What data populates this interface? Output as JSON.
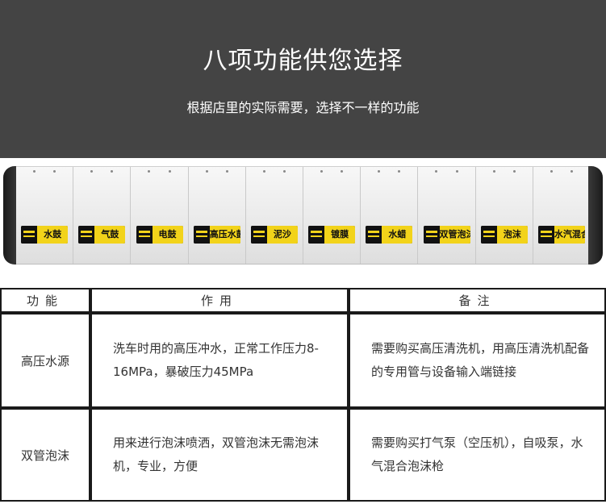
{
  "header": {
    "title": "八项功能供您选择",
    "subtitle": "根据店里的实际需要，选择不一样的功能"
  },
  "product": {
    "modules": [
      {
        "label": "水鼓"
      },
      {
        "label": "气鼓"
      },
      {
        "label": "电鼓"
      },
      {
        "label": "高压水鼓"
      },
      {
        "label": "泥沙"
      },
      {
        "label": "镀膜"
      },
      {
        "label": "水蜡"
      },
      {
        "label": "双管泡沫"
      },
      {
        "label": "泡沫"
      },
      {
        "label": "水汽混合"
      }
    ]
  },
  "table": {
    "headers": [
      "功能",
      "作用",
      "备注"
    ],
    "rows": [
      {
        "function": "高压水源",
        "usage": "洗车时用的高压冲水，正常工作压力8-16MPa，暴破压力45MPa",
        "note": "需要购买高压清洗机，用高压清洗机配备的专用管与设备输入端链接"
      },
      {
        "function": "双管泡沫",
        "usage": "用来进行泡沫喷洒，双管泡沫无需泡沫机，专业，方便",
        "note": "需要购买打气泵（空压机），自吸泵，水气混合泡沫枪"
      }
    ]
  },
  "colors": {
    "banner": "#444444",
    "label_yellow": "#f2d31a",
    "border": "#1a1a1a"
  }
}
